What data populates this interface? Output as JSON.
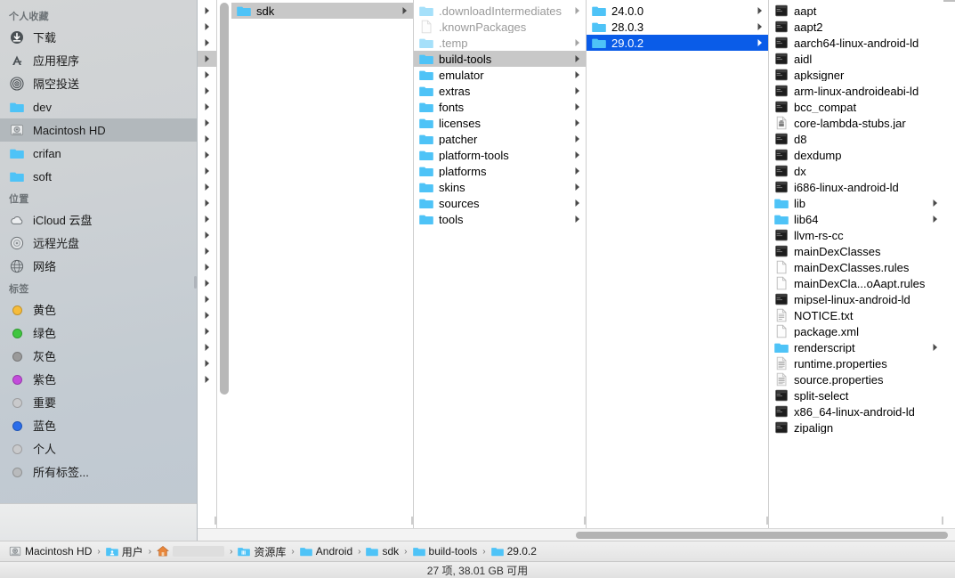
{
  "sidebar": {
    "sections": [
      {
        "title": "个人收藏",
        "items": [
          {
            "label": "下载",
            "icon": "download-icon",
            "selected": false
          },
          {
            "label": "应用程序",
            "icon": "applications-icon",
            "selected": false
          },
          {
            "label": "隔空投送",
            "icon": "airdrop-icon",
            "selected": false
          },
          {
            "label": "dev",
            "icon": "folder-icon",
            "selected": false
          },
          {
            "label": "Macintosh HD",
            "icon": "harddisk-icon",
            "selected": true
          },
          {
            "label": "crifan",
            "icon": "folder-icon",
            "selected": false
          },
          {
            "label": "soft",
            "icon": "folder-icon",
            "selected": false
          }
        ]
      },
      {
        "title": "位置",
        "items": [
          {
            "label": "iCloud 云盘",
            "icon": "icloud-icon",
            "selected": false
          },
          {
            "label": "远程光盘",
            "icon": "remote-disc-icon",
            "selected": false
          },
          {
            "label": "网络",
            "icon": "network-icon",
            "selected": false
          }
        ]
      },
      {
        "title": "标签",
        "items": [
          {
            "label": "黄色",
            "icon": "tag-dot-icon",
            "color": "#f6bc3a",
            "selected": false
          },
          {
            "label": "绿色",
            "icon": "tag-dot-icon",
            "color": "#3fc63f",
            "selected": false
          },
          {
            "label": "灰色",
            "icon": "tag-dot-icon",
            "color": "#9a9a9a",
            "selected": false
          },
          {
            "label": "紫色",
            "icon": "tag-dot-icon",
            "color": "#c34bdb",
            "selected": false
          },
          {
            "label": "重要",
            "icon": "tag-dot-icon",
            "color": "#c9cacc",
            "selected": false
          },
          {
            "label": "蓝色",
            "icon": "tag-dot-icon",
            "color": "#2a6dea",
            "selected": false
          },
          {
            "label": "个人",
            "icon": "tag-dot-icon",
            "color": "#c9cacc",
            "selected": false
          },
          {
            "label": "所有标签...",
            "icon": "tag-dot-icon",
            "color": "#b9bbbd",
            "selected": false
          }
        ]
      }
    ]
  },
  "columns": {
    "col_scrolled_arrows": {
      "name": "partially-scrolled-column",
      "row_count": 24,
      "selected_index": 3
    },
    "col_sdk_parent": {
      "items": [
        {
          "label": "sdk",
          "icon": "folder-icon",
          "kind": "folder",
          "has_arrow": true,
          "state": "inactive-selected"
        }
      ]
    },
    "col_sdk": {
      "items": [
        {
          "label": ".downloadIntermediates",
          "icon": "folder-icon",
          "kind": "folder",
          "has_arrow": true,
          "dim": true
        },
        {
          "label": ".knownPackages",
          "icon": "file-icon",
          "kind": "file",
          "has_arrow": false,
          "dim": true
        },
        {
          "label": ".temp",
          "icon": "folder-icon",
          "kind": "folder",
          "has_arrow": true,
          "dim": true
        },
        {
          "label": "build-tools",
          "icon": "folder-icon",
          "kind": "folder",
          "has_arrow": true,
          "dim": false,
          "state": "inactive-selected"
        },
        {
          "label": "emulator",
          "icon": "folder-icon",
          "kind": "folder",
          "has_arrow": true,
          "dim": false
        },
        {
          "label": "extras",
          "icon": "folder-icon",
          "kind": "folder",
          "has_arrow": true,
          "dim": false
        },
        {
          "label": "fonts",
          "icon": "folder-icon",
          "kind": "folder",
          "has_arrow": true,
          "dim": false
        },
        {
          "label": "licenses",
          "icon": "folder-icon",
          "kind": "folder",
          "has_arrow": true,
          "dim": false
        },
        {
          "label": "patcher",
          "icon": "folder-icon",
          "kind": "folder",
          "has_arrow": true,
          "dim": false
        },
        {
          "label": "platform-tools",
          "icon": "folder-icon",
          "kind": "folder",
          "has_arrow": true,
          "dim": false
        },
        {
          "label": "platforms",
          "icon": "folder-icon",
          "kind": "folder",
          "has_arrow": true,
          "dim": false
        },
        {
          "label": "skins",
          "icon": "folder-icon",
          "kind": "folder",
          "has_arrow": true,
          "dim": false
        },
        {
          "label": "sources",
          "icon": "folder-icon",
          "kind": "folder",
          "has_arrow": true,
          "dim": false
        },
        {
          "label": "tools",
          "icon": "folder-icon",
          "kind": "folder",
          "has_arrow": true,
          "dim": false
        }
      ]
    },
    "col_build_tools": {
      "items": [
        {
          "label": "24.0.0",
          "icon": "folder-icon",
          "kind": "folder",
          "has_arrow": true,
          "dim": false
        },
        {
          "label": "28.0.3",
          "icon": "folder-icon",
          "kind": "folder",
          "has_arrow": true,
          "dim": false
        },
        {
          "label": "29.0.2",
          "icon": "folder-icon",
          "kind": "folder",
          "has_arrow": true,
          "dim": false,
          "state": "active-selected"
        }
      ]
    },
    "col_version": {
      "items": [
        {
          "label": "aapt",
          "icon": "unix-executable-icon",
          "kind": "exec",
          "has_arrow": false
        },
        {
          "label": "aapt2",
          "icon": "unix-executable-icon",
          "kind": "exec",
          "has_arrow": false
        },
        {
          "label": "aarch64-linux-android-ld",
          "icon": "unix-executable-icon",
          "kind": "exec",
          "has_arrow": false
        },
        {
          "label": "aidl",
          "icon": "unix-executable-icon",
          "kind": "exec",
          "has_arrow": false
        },
        {
          "label": "apksigner",
          "icon": "unix-executable-icon",
          "kind": "exec",
          "has_arrow": false
        },
        {
          "label": "arm-linux-androideabi-ld",
          "icon": "unix-executable-icon",
          "kind": "exec",
          "has_arrow": false
        },
        {
          "label": "bcc_compat",
          "icon": "unix-executable-icon",
          "kind": "exec",
          "has_arrow": false
        },
        {
          "label": "core-lambda-stubs.jar",
          "icon": "jar-icon",
          "kind": "jar",
          "has_arrow": false
        },
        {
          "label": "d8",
          "icon": "unix-executable-icon",
          "kind": "exec",
          "has_arrow": false
        },
        {
          "label": "dexdump",
          "icon": "unix-executable-icon",
          "kind": "exec",
          "has_arrow": false
        },
        {
          "label": "dx",
          "icon": "unix-executable-icon",
          "kind": "exec",
          "has_arrow": false
        },
        {
          "label": "i686-linux-android-ld",
          "icon": "unix-executable-icon",
          "kind": "exec",
          "has_arrow": false
        },
        {
          "label": "lib",
          "icon": "folder-icon",
          "kind": "folder",
          "has_arrow": true
        },
        {
          "label": "lib64",
          "icon": "folder-icon",
          "kind": "folder",
          "has_arrow": true
        },
        {
          "label": "llvm-rs-cc",
          "icon": "unix-executable-icon",
          "kind": "exec",
          "has_arrow": false
        },
        {
          "label": "mainDexClasses",
          "icon": "unix-executable-icon",
          "kind": "exec",
          "has_arrow": false
        },
        {
          "label": "mainDexClasses.rules",
          "icon": "file-icon",
          "kind": "file",
          "has_arrow": false
        },
        {
          "label": "mainDexCla...oAapt.rules",
          "icon": "file-icon",
          "kind": "file",
          "has_arrow": false
        },
        {
          "label": "mipsel-linux-android-ld",
          "icon": "unix-executable-icon",
          "kind": "exec",
          "has_arrow": false
        },
        {
          "label": "NOTICE.txt",
          "icon": "text-file-icon",
          "kind": "text",
          "has_arrow": false
        },
        {
          "label": "package.xml",
          "icon": "file-icon",
          "kind": "file",
          "has_arrow": false
        },
        {
          "label": "renderscript",
          "icon": "folder-icon",
          "kind": "folder",
          "has_arrow": true
        },
        {
          "label": "runtime.properties",
          "icon": "properties-file-icon",
          "kind": "props",
          "has_arrow": false
        },
        {
          "label": "source.properties",
          "icon": "properties-file-icon",
          "kind": "props",
          "has_arrow": false
        },
        {
          "label": "split-select",
          "icon": "unix-executable-icon",
          "kind": "exec",
          "has_arrow": false
        },
        {
          "label": "x86_64-linux-android-ld",
          "icon": "unix-executable-icon",
          "kind": "exec",
          "has_arrow": false
        },
        {
          "label": "zipalign",
          "icon": "unix-executable-icon",
          "kind": "exec",
          "has_arrow": false
        }
      ]
    }
  },
  "pathbar": {
    "crumbs": [
      {
        "label": "Macintosh HD",
        "icon": "harddisk-icon",
        "blank": false
      },
      {
        "label": "用户",
        "icon": "users-folder-icon",
        "blank": false
      },
      {
        "label": "",
        "icon": "home-folder-icon",
        "blank": true
      },
      {
        "label": "资源库",
        "icon": "library-folder-icon",
        "blank": false
      },
      {
        "label": "Android",
        "icon": "folder-icon",
        "blank": false
      },
      {
        "label": "sdk",
        "icon": "folder-icon",
        "blank": false
      },
      {
        "label": "build-tools",
        "icon": "folder-icon",
        "blank": false
      },
      {
        "label": "29.0.2",
        "icon": "folder-icon",
        "blank": false
      }
    ],
    "separator": "›"
  },
  "statusbar": {
    "text": "27 项, 38.01 GB 可用"
  },
  "colors": {
    "selection_active": "#0a5ce8",
    "selection_inactive": "#c8c8c8",
    "folder_blue": "#4ec3f7",
    "sidebar_bg": "#cdd1d4"
  }
}
